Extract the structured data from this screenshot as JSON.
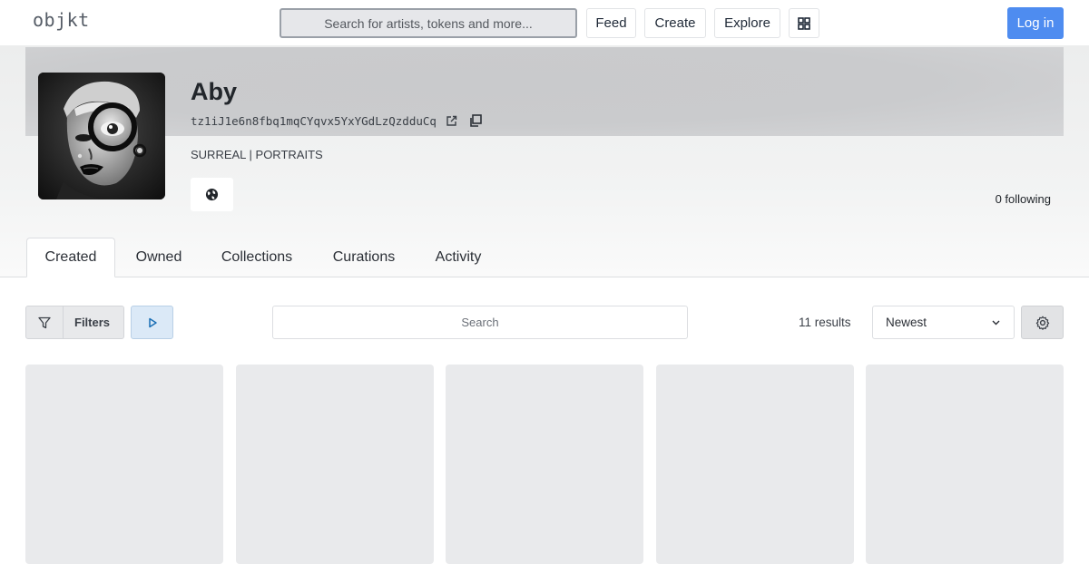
{
  "header": {
    "logo": "objkt",
    "search_placeholder": "Search for artists, tokens and more...",
    "nav": {
      "feed": "Feed",
      "create": "Create",
      "explore": "Explore"
    },
    "login": "Log in",
    "icons": {
      "grid": "grid-icon"
    }
  },
  "profile": {
    "name": "Aby",
    "wallet": "tz1iJ1e6n8fbq1mqCYqvx5YxYGdLzQzdduCq",
    "bio": "SURREAL | PORTRAITS",
    "following": "0 following",
    "icons": {
      "external": "external-link-icon",
      "copy": "copy-icon",
      "website": "globe-icon"
    }
  },
  "tabs": [
    {
      "label": "Created",
      "active": true
    },
    {
      "label": "Owned",
      "active": false
    },
    {
      "label": "Collections",
      "active": false
    },
    {
      "label": "Curations",
      "active": false
    },
    {
      "label": "Activity",
      "active": false
    }
  ],
  "toolbar": {
    "filters": "Filters",
    "search_placeholder": "Search",
    "results": "11 results",
    "sort": "Newest",
    "icons": {
      "filter": "filter-icon",
      "play": "play-icon",
      "sort": "chevron-down-icon",
      "settings": "gear-icon"
    }
  },
  "colors": {
    "accent": "#4e8cf0",
    "play_button_bg": "#dbe9f7",
    "placeholder_card": "#e9eaec"
  }
}
